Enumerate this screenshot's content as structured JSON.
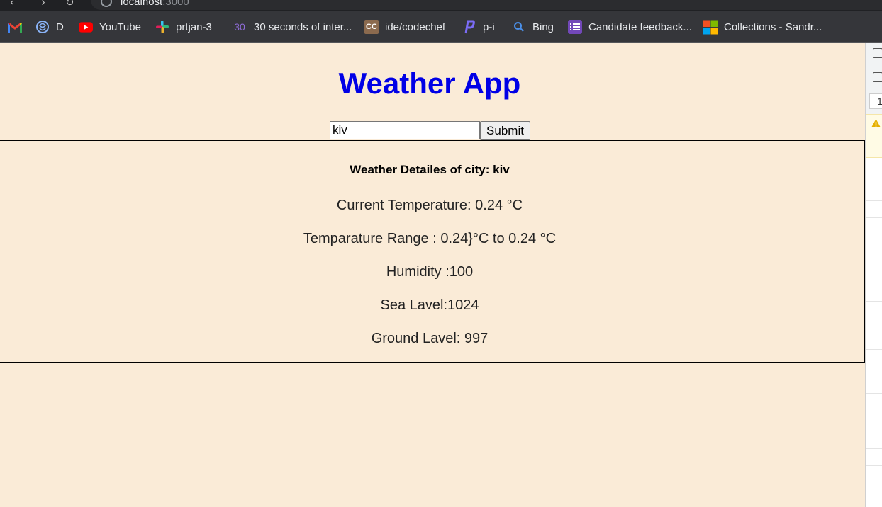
{
  "browser": {
    "url_host": "localhost",
    "url_port": ":3000",
    "bookmarks": [
      {
        "label": "",
        "icon": "gmail-icon"
      },
      {
        "label": "D",
        "icon": "brain-icon"
      },
      {
        "label": "YouTube",
        "icon": "youtube-icon"
      },
      {
        "label": "prtjan-3",
        "icon": "slack-icon"
      },
      {
        "label": "30 seconds of inter...",
        "icon": "thirty-icon",
        "icon_text": "30"
      },
      {
        "label": "ide/codechef",
        "icon": "codechef-icon",
        "icon_text": "CC"
      },
      {
        "label": "p-i",
        "icon": "bookmark-p-icon"
      },
      {
        "label": "Bing",
        "icon": "search-icon"
      },
      {
        "label": "Candidate feedback...",
        "icon": "forms-icon"
      },
      {
        "label": "Collections - Sandr...",
        "icon": "microsoft-icon"
      }
    ]
  },
  "app": {
    "title": "Weather App",
    "search": {
      "value": "kiv",
      "submit_label": "Submit"
    },
    "details": {
      "heading": "Weather Detailes of city: kiv",
      "current_temperature": "Current Temperature: 0.24 °C",
      "temperature_range": "Temparature Range : 0.24}°C to 0.24 °C",
      "humidity": "Humidity :100",
      "sea_level": "Sea Lavel:1024",
      "ground_level": "Ground Lavel: 997"
    }
  },
  "devtools": {
    "line_number": "1"
  },
  "colors": {
    "page_bg": "#faebd7",
    "title": "#0000e6",
    "chrome_dark": "#202124",
    "bookmarks_bar": "#35363a"
  }
}
